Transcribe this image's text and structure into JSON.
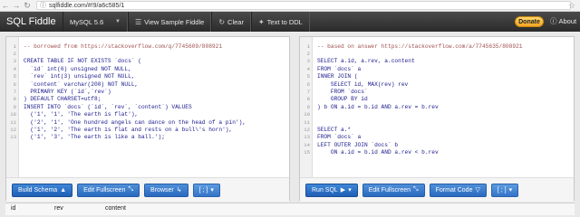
{
  "browser": {
    "url": "sqlfiddle.com/#!9/a6c585/1"
  },
  "navbar": {
    "brand": "SQL Fiddle",
    "db_select": "MySQL 5.6",
    "view_sample": "View Sample Fiddle",
    "clear": "Clear",
    "text_to_ddl": "Text to DDL",
    "donate": "Donate",
    "about": "About"
  },
  "schema_panel": {
    "lines": [
      {
        "n": "1",
        "text": "-- borrowed from https://stackoverflow.com/q/7745609/808921",
        "type": "comment"
      },
      {
        "n": "2",
        "text": "",
        "type": "code"
      },
      {
        "n": "3",
        "text": "CREATE TABLE IF NOT EXISTS `docs` (",
        "type": "code"
      },
      {
        "n": "4",
        "text": "  `id` int(6) unsigned NOT NULL,",
        "type": "code"
      },
      {
        "n": "5",
        "text": "  `rev` int(3) unsigned NOT NULL,",
        "type": "code"
      },
      {
        "n": "6",
        "text": "  `content` varchar(200) NOT NULL,",
        "type": "code"
      },
      {
        "n": "7",
        "text": "  PRIMARY KEY (`id`,`rev`)",
        "type": "code"
      },
      {
        "n": "8",
        "text": ") DEFAULT CHARSET=utf8;",
        "type": "code"
      },
      {
        "n": "9",
        "text": "INSERT INTO `docs` (`id`, `rev`, `content`) VALUES",
        "type": "code"
      },
      {
        "n": "10",
        "text": "  ('1', '1', 'The earth is flat'),",
        "type": "code"
      },
      {
        "n": "11",
        "text": "  ('2', '1', 'One hundred angels can dance on the head of a pin'),",
        "type": "code"
      },
      {
        "n": "12",
        "text": "  ('1', '2', 'The earth is flat and rests on a bull\\'s horn'),",
        "type": "code"
      },
      {
        "n": "13",
        "text": "  ('1', '3', 'The earth is like a ball.');",
        "type": "code"
      }
    ],
    "build_schema": "Build Schema",
    "edit_fullscreen": "Edit Fullscreen",
    "browser": "Browser",
    "terminator": "[ ; ]"
  },
  "query_panel": {
    "lines": [
      {
        "n": "1",
        "text": "-- based on answer https://stackoverflow.com/a/7745635/808921",
        "type": "comment"
      },
      {
        "n": "2",
        "text": "",
        "type": "code"
      },
      {
        "n": "3",
        "text": "SELECT a.id, a.rev, a.content",
        "type": "code"
      },
      {
        "n": "4",
        "text": "FROM `docs` a",
        "type": "code"
      },
      {
        "n": "5",
        "text": "INNER JOIN (",
        "type": "code"
      },
      {
        "n": "6",
        "text": "    SELECT id, MAX(rev) rev",
        "type": "code"
      },
      {
        "n": "7",
        "text": "    FROM `docs`",
        "type": "code"
      },
      {
        "n": "8",
        "text": "    GROUP BY id",
        "type": "code"
      },
      {
        "n": "9",
        "text": ") b ON a.id = b.id AND a.rev = b.rev",
        "type": "code"
      },
      {
        "n": "10",
        "text": "",
        "type": "code"
      },
      {
        "n": "11",
        "text": "",
        "type": "code"
      },
      {
        "n": "12",
        "text": "SELECT a.*",
        "type": "code"
      },
      {
        "n": "13",
        "text": "FROM `docs` a",
        "type": "code"
      },
      {
        "n": "14",
        "text": "LEFT OUTER JOIN `docs` b",
        "type": "code"
      },
      {
        "n": "15",
        "text": "    ON a.id = b.id AND a.rev < b.rev",
        "type": "code"
      }
    ],
    "run_sql": "Run SQL",
    "edit_fullscreen": "Edit Fullscreen",
    "format_code": "Format Code",
    "terminator": "[ ; ]"
  },
  "results": {
    "columns": [
      "id",
      "rev",
      "content"
    ]
  }
}
